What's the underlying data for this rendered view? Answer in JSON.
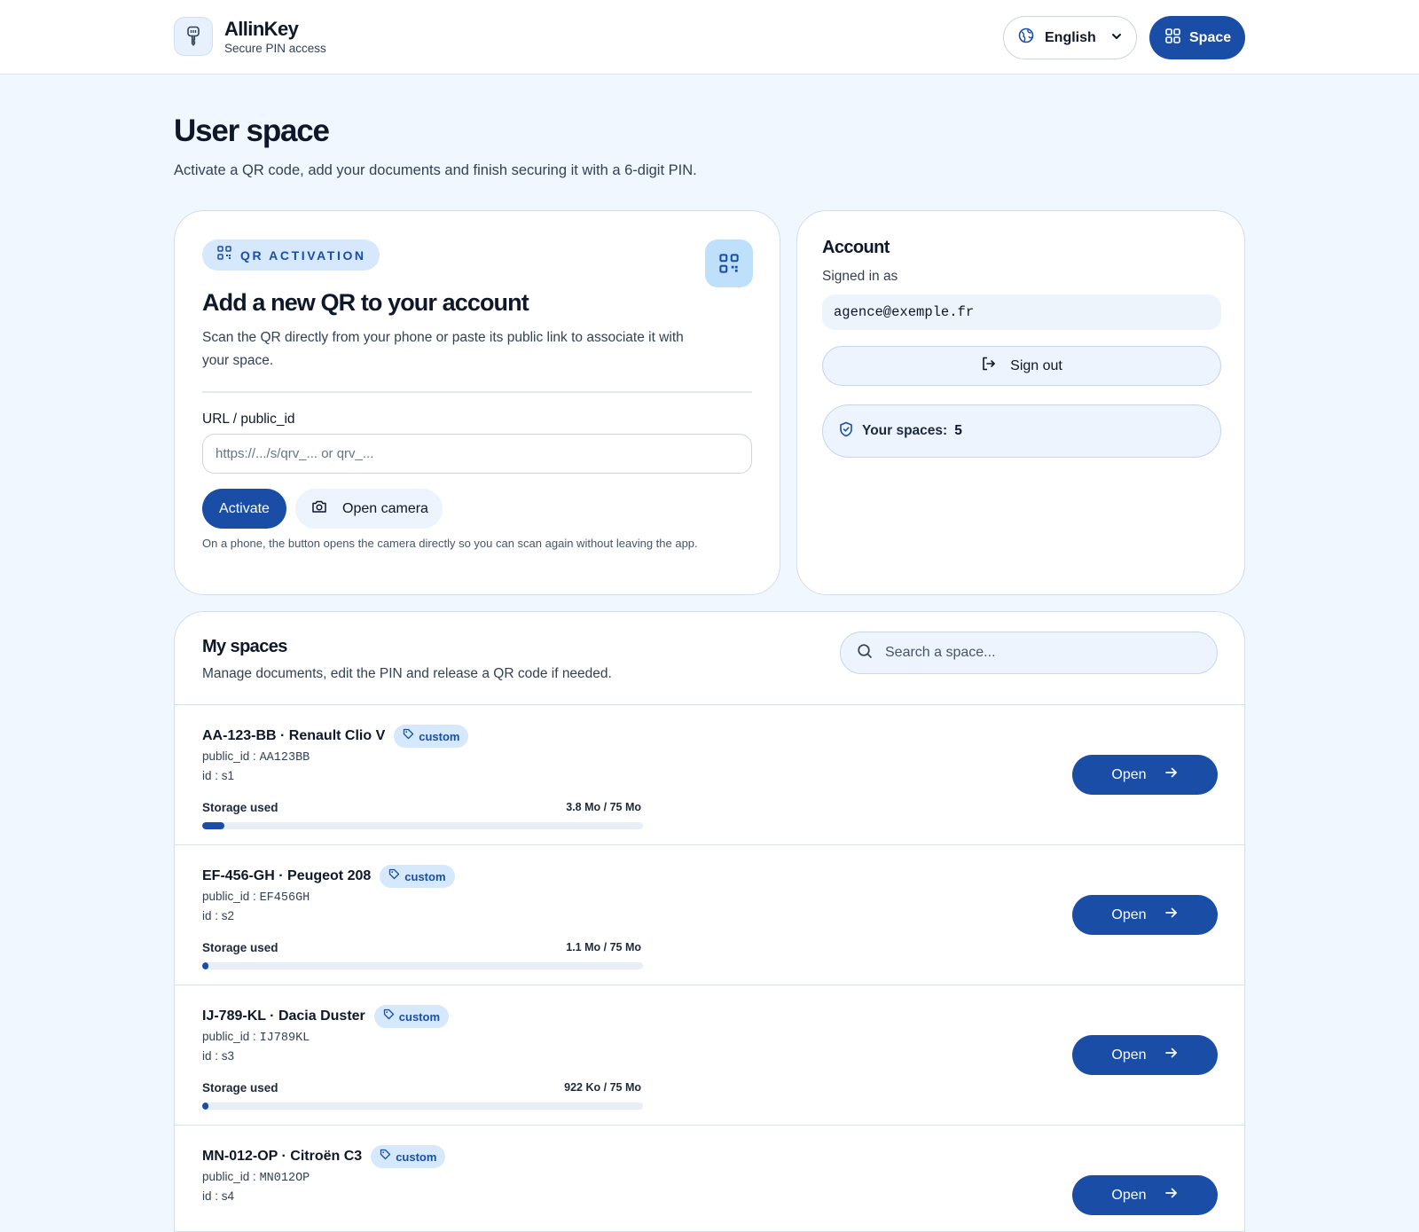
{
  "header": {
    "brand_name": "AllinKey",
    "brand_sub": "Secure PIN access",
    "language": "English",
    "space_button": "Space"
  },
  "page": {
    "title": "User space",
    "subtitle": "Activate a QR code, add your documents and finish securing it with a 6-digit PIN."
  },
  "qr_activation": {
    "pill": "QR ACTIVATION",
    "title": "Add a new QR to your account",
    "description": "Scan the QR directly from your phone or paste its public link to associate it with your space.",
    "field_label": "URL / public_id",
    "placeholder": "https://.../s/qrv_... or qrv_...",
    "activate_label": "Activate",
    "camera_label": "Open camera",
    "note": "On a phone, the button opens the camera directly so you can scan again without leaving the app."
  },
  "account": {
    "title": "Account",
    "signed_in_as": "Signed in as",
    "email": "agence@exemple.fr",
    "sign_out": "Sign out",
    "spaces_label": "Your spaces:",
    "spaces_count": "5"
  },
  "my_spaces": {
    "title": "My spaces",
    "subtitle": "Manage documents, edit the PIN and release a QR code if needed.",
    "search_placeholder": "Search a space...",
    "items": [
      {
        "name": "AA-123-BB · Renault Clio V",
        "tag": "custom",
        "public_id_label": "public_id :",
        "public_id": "AA123BB",
        "id_label": "id :",
        "id": "s1",
        "storage_label": "Storage used",
        "storage_value": "3.8 Mo / 75 Mo",
        "storage_fraction": 0.0507,
        "open_label": "Open"
      },
      {
        "name": "EF-456-GH · Peugeot 208",
        "tag": "custom",
        "public_id_label": "public_id :",
        "public_id": "EF456GH",
        "id_label": "id :",
        "id": "s2",
        "storage_label": "Storage used",
        "storage_value": "1.1 Mo / 75 Mo",
        "storage_fraction": 0.0147,
        "open_label": "Open"
      },
      {
        "name": "IJ-789-KL · Dacia Duster",
        "tag": "custom",
        "public_id_label": "public_id :",
        "public_id": "IJ789KL",
        "id_label": "id :",
        "id": "s3",
        "storage_label": "Storage used",
        "storage_value": "922 Ko / 75 Mo",
        "storage_fraction": 0.012,
        "open_label": "Open"
      },
      {
        "name": "MN-012-OP · Citroën C3",
        "tag": "custom",
        "public_id_label": "public_id :",
        "public_id": "MN012OP",
        "id_label": "id :",
        "id": "s4",
        "open_label": "Open"
      }
    ]
  },
  "colors": {
    "primary": "#1a4ea6",
    "page_bg": "#f1f7fe",
    "pill_bg": "#d6e8fb"
  },
  "icons": [
    "key-icon",
    "globe-icon",
    "chevron-down-icon",
    "grid-icon",
    "qr-code-icon",
    "camera-icon",
    "sign-out-icon",
    "shield-icon",
    "search-icon",
    "tag-icon",
    "arrow-right-icon"
  ]
}
